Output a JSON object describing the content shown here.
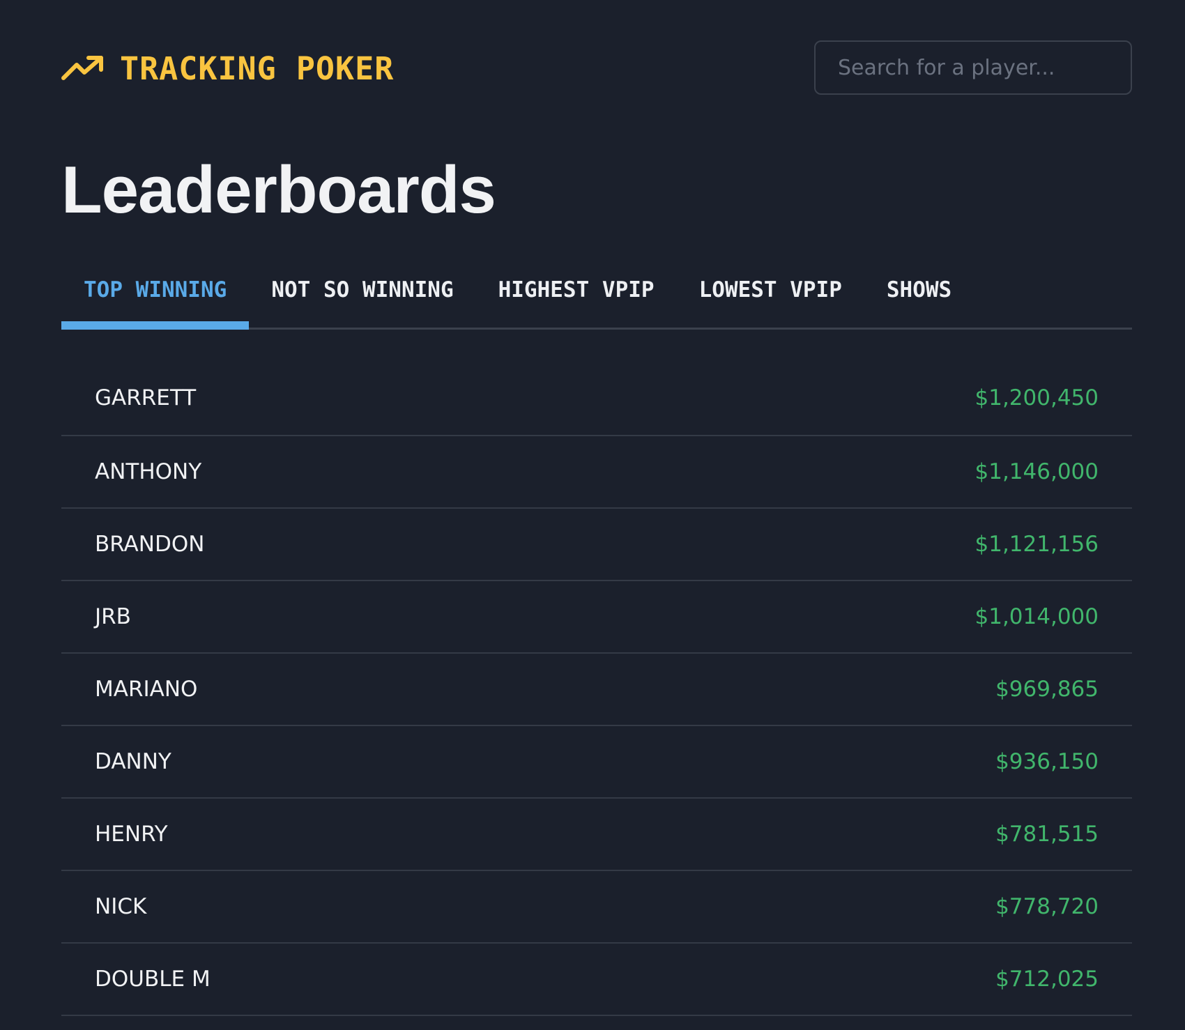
{
  "header": {
    "brand_icon": "trending-up-icon",
    "brand_title": "TRACKING POKER",
    "brand_color": "#f9c440",
    "search_placeholder": "Search for a player..."
  },
  "page_title": "Leaderboards",
  "tabs": [
    {
      "label": "TOP WINNING",
      "active": true
    },
    {
      "label": "NOT SO WINNING",
      "active": false
    },
    {
      "label": "HIGHEST VPIP",
      "active": false
    },
    {
      "label": "LOWEST VPIP",
      "active": false
    },
    {
      "label": "SHOWS",
      "active": false
    }
  ],
  "accent_color": "#5aaae8",
  "amount_color": "#41b66c",
  "leaderboard": [
    {
      "name": "GARRETT",
      "amount": "$1,200,450"
    },
    {
      "name": "ANTHONY",
      "amount": "$1,146,000"
    },
    {
      "name": "BRANDON",
      "amount": "$1,121,156"
    },
    {
      "name": "JRB",
      "amount": "$1,014,000"
    },
    {
      "name": "MARIANO",
      "amount": "$969,865"
    },
    {
      "name": "DANNY",
      "amount": "$936,150"
    },
    {
      "name": "HENRY",
      "amount": "$781,515"
    },
    {
      "name": "NICK",
      "amount": "$778,720"
    },
    {
      "name": "DOUBLE M",
      "amount": "$712,025"
    }
  ]
}
